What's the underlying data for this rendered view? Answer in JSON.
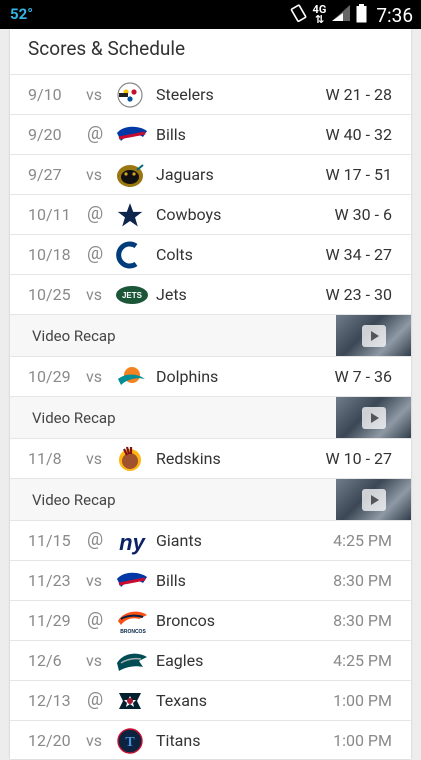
{
  "status_bar": {
    "temperature": "52°",
    "network": "4G",
    "time": "7:36"
  },
  "card": {
    "title": "Scores & Schedule"
  },
  "rows": [
    {
      "type": "game",
      "date": "9/10",
      "venue": "vs",
      "team": "Steelers",
      "result": "W 21 - 28",
      "logo": "steelers-logo-icon"
    },
    {
      "type": "game",
      "date": "9/20",
      "venue": "@",
      "team": "Bills",
      "result": "W 40 - 32",
      "logo": "bills-logo-icon"
    },
    {
      "type": "game",
      "date": "9/27",
      "venue": "vs",
      "team": "Jaguars",
      "result": "W 17 - 51",
      "logo": "jaguars-logo-icon"
    },
    {
      "type": "game",
      "date": "10/11",
      "venue": "@",
      "team": "Cowboys",
      "result": "W 30 - 6",
      "logo": "cowboys-logo-icon"
    },
    {
      "type": "game",
      "date": "10/18",
      "venue": "@",
      "team": "Colts",
      "result": "W 34 - 27",
      "logo": "colts-logo-icon"
    },
    {
      "type": "game",
      "date": "10/25",
      "venue": "vs",
      "team": "Jets",
      "result": "W 23 - 30",
      "logo": "jets-logo-icon"
    },
    {
      "type": "video",
      "label": "Video Recap"
    },
    {
      "type": "game",
      "date": "10/29",
      "venue": "vs",
      "team": "Dolphins",
      "result": "W 7 - 36",
      "logo": "dolphins-logo-icon"
    },
    {
      "type": "video",
      "label": "Video Recap"
    },
    {
      "type": "game",
      "date": "11/8",
      "venue": "vs",
      "team": "Redskins",
      "result": "W 10 - 27",
      "logo": "redskins-logo-icon"
    },
    {
      "type": "video",
      "label": "Video Recap"
    },
    {
      "type": "game",
      "date": "11/15",
      "venue": "@",
      "team": "Giants",
      "result": "4:25 PM",
      "logo": "giants-logo-icon",
      "upcoming": true
    },
    {
      "type": "game",
      "date": "11/23",
      "venue": "vs",
      "team": "Bills",
      "result": "8:30 PM",
      "logo": "bills-logo-icon",
      "upcoming": true
    },
    {
      "type": "game",
      "date": "11/29",
      "venue": "@",
      "team": "Broncos",
      "result": "8:30 PM",
      "logo": "broncos-logo-icon",
      "upcoming": true
    },
    {
      "type": "game",
      "date": "12/6",
      "venue": "vs",
      "team": "Eagles",
      "result": "4:25 PM",
      "logo": "eagles-logo-icon",
      "upcoming": true
    },
    {
      "type": "game",
      "date": "12/13",
      "venue": "@",
      "team": "Texans",
      "result": "1:00 PM",
      "logo": "texans-logo-icon",
      "upcoming": true
    },
    {
      "type": "game",
      "date": "12/20",
      "venue": "vs",
      "team": "Titans",
      "result": "1:00 PM",
      "logo": "titans-logo-icon",
      "upcoming": true
    }
  ],
  "colors": {
    "status_accent": "#33b5e5",
    "text_primary": "#333333",
    "text_secondary": "#8a8a8a",
    "divider": "#e6e6e6"
  }
}
